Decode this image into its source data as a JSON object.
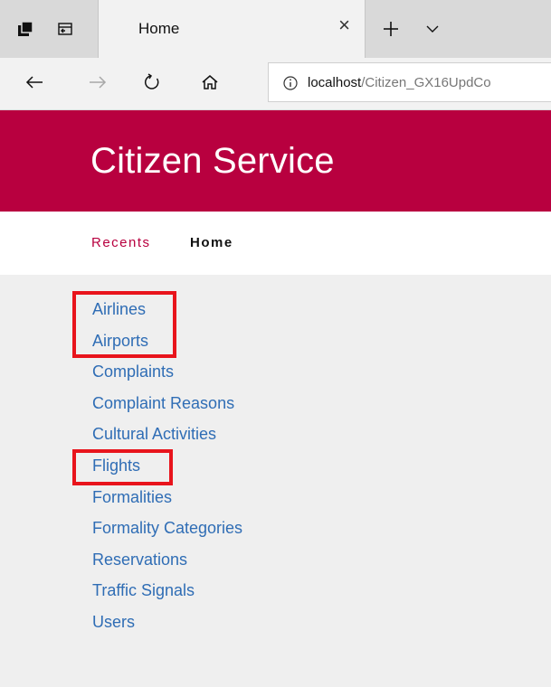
{
  "browser": {
    "tab": {
      "title": "Home",
      "close_glyph": "×"
    },
    "new_tab_glyph": "+",
    "tab_list_glyph": "⌄",
    "address": {
      "host": "localhost",
      "path": "/Citizen_GX16UpdCo"
    },
    "icons": [
      "tab-preview-icon",
      "set-tabs-aside-icon",
      "close-icon",
      "plus-icon",
      "chevron-down-icon",
      "back-arrow-icon",
      "forward-arrow-icon",
      "refresh-icon",
      "home-icon",
      "info-icon"
    ]
  },
  "header": {
    "title": "Citizen Service",
    "color": "#b8003f"
  },
  "breadcrumb": {
    "recents": "Recents",
    "current": "Home"
  },
  "menu": {
    "items": [
      "Airlines",
      "Airports",
      "Complaints",
      "Complaint Reasons",
      "Cultural Activities",
      "Flights",
      "Formalities",
      "Formality Categories",
      "Reservations",
      "Traffic Signals",
      "Users"
    ],
    "link_color": "#2f6db5"
  },
  "highlight_color": "#e8141c"
}
